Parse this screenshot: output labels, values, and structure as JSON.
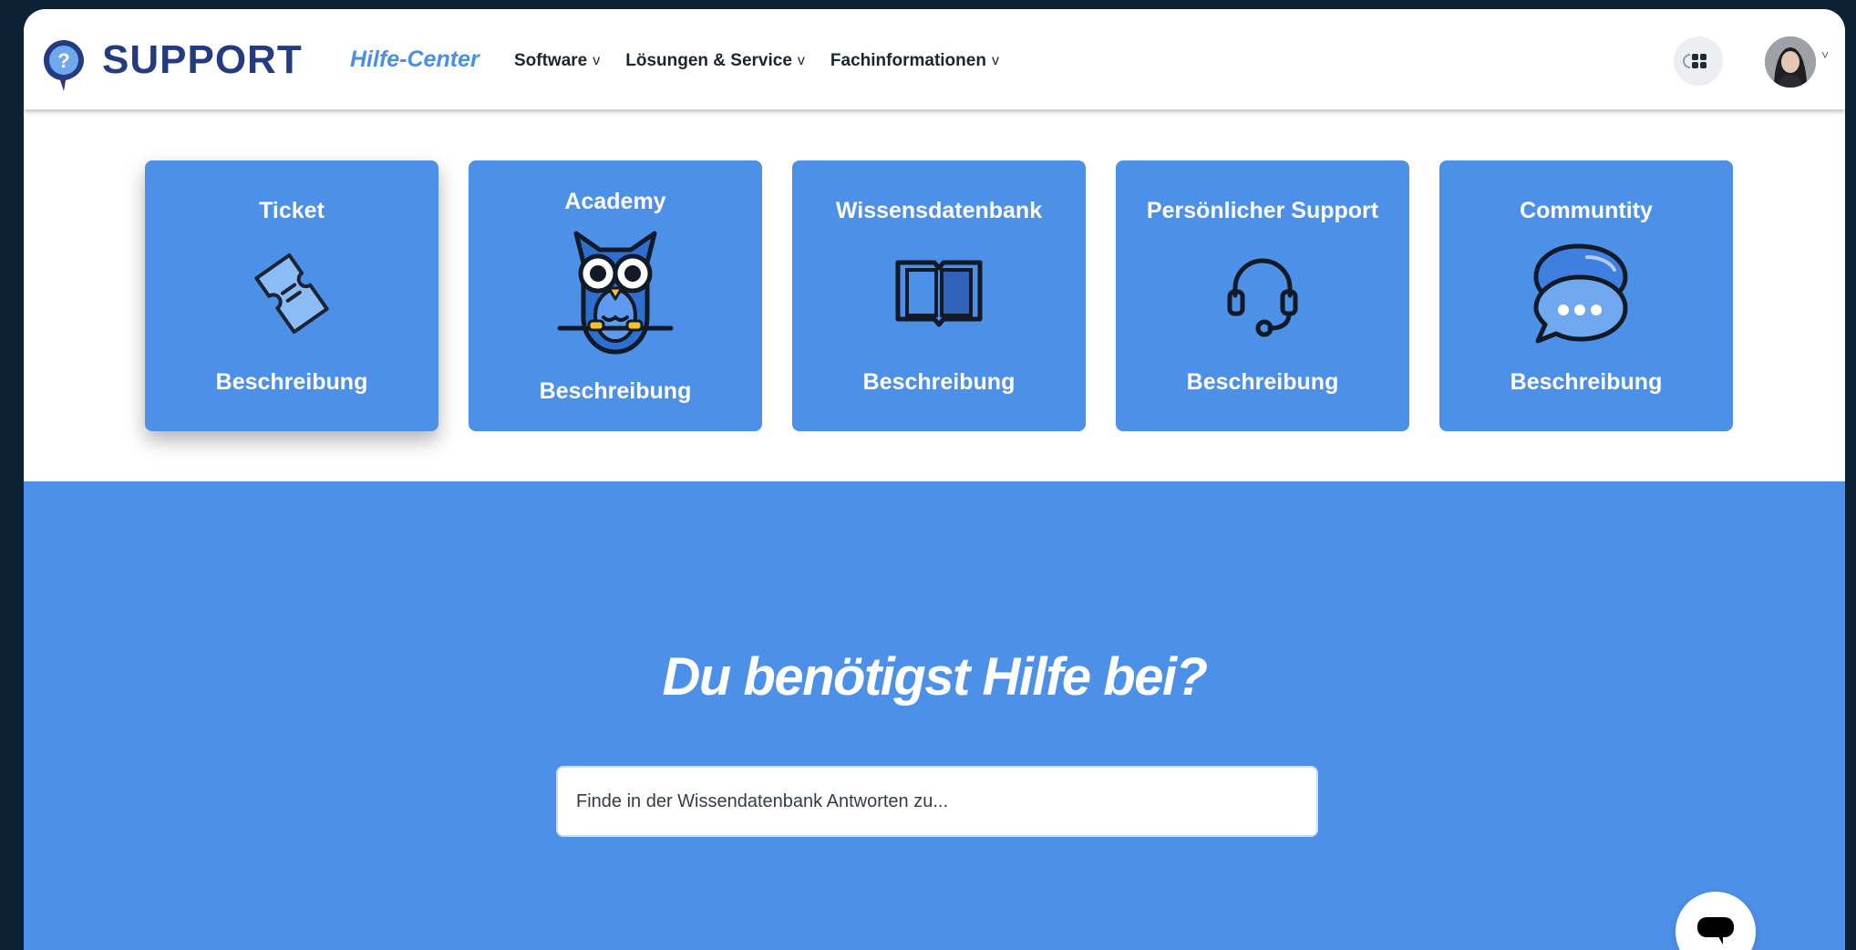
{
  "header": {
    "brand": "SUPPORT",
    "subbrand": "Hilfe-Center",
    "nav": [
      {
        "label": "Software",
        "chevron": "v"
      },
      {
        "label": "Lösungen & Service",
        "chevron": "v"
      },
      {
        "label": "Fachinformationen",
        "chevron": "v"
      }
    ],
    "avatar_chevron": "˅"
  },
  "cards": [
    {
      "title": "Ticket",
      "description": "Beschreibung",
      "icon": "ticket-icon"
    },
    {
      "title": "Academy",
      "description": "Beschreibung",
      "icon": "owl-icon"
    },
    {
      "title": "Wissensdatenbank",
      "description": "Beschreibung",
      "icon": "book-icon"
    },
    {
      "title": "Persönlicher Support",
      "description": "Beschreibung",
      "icon": "headset-icon"
    },
    {
      "title": "Communtity",
      "description": "Beschreibung",
      "icon": "chat-bubbles-icon"
    }
  ],
  "hero": {
    "title": "Du benötigst Hilfe bei?",
    "search_placeholder": "Finde in der Wissendatenbank Antworten zu..."
  },
  "colors": {
    "brand": "#253b80",
    "accent": "#4d90e8",
    "background": "#0c2133"
  }
}
